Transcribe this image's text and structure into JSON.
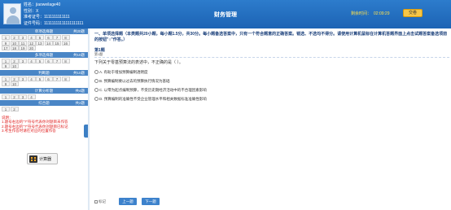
{
  "header": {
    "name_label": "姓名：",
    "name_value": "jiaoweilage40",
    "gender_label": "性别：",
    "gender_value": "X",
    "exam_id_label": "准考证号：",
    "exam_id_value": "1111111111111",
    "id_card_label": "证件号码：",
    "id_card_value": "11111111111111111111",
    "title": "财务管理",
    "time_label": "剩余时间：",
    "time_value": "02:09:29",
    "submit_label": "交卷"
  },
  "sidebar": {
    "sections": [
      {
        "title": "单项选择题",
        "count": "共20题",
        "rows": [
          [
            "1",
            "2",
            "3",
            "4",
            "5",
            "6",
            "7",
            "8"
          ],
          [
            "9",
            "10",
            "11",
            "12",
            "13",
            "14",
            "15",
            "16"
          ],
          [
            "17",
            "18",
            "19",
            "20"
          ]
        ]
      },
      {
        "title": "多项选择题",
        "count": "共10题",
        "rows": [
          [
            "1",
            "2",
            "3",
            "4",
            "5",
            "6",
            "7",
            "8"
          ],
          [
            "9",
            "10"
          ]
        ]
      },
      {
        "title": "判断题",
        "count": "共10题",
        "rows": [
          [
            "1",
            "2",
            "3",
            "4",
            "5",
            "6",
            "7",
            "8"
          ],
          [
            "9",
            "10"
          ]
        ]
      },
      {
        "title": "计算分析题",
        "count": "共4题",
        "rows": [
          [
            "1",
            "2",
            "3",
            "4"
          ]
        ]
      },
      {
        "title": "综合题",
        "count": "共2题",
        "rows": [
          [
            "1",
            "2"
          ]
        ]
      }
    ],
    "note_title": "说明：",
    "note_lines": [
      "1.题号右边的\"?\"符号代表你对题目未作答",
      "2.题号右边的\"?\"符号代表你对题目已标记",
      "3.考生作答时请在对应的位置作答"
    ],
    "calc_label": "计算器"
  },
  "main": {
    "section_title": "一、单项选择题（本类题共20小题，每小题1.5分，共30分。每小题备选答案中，只有一个符合题意的正确答案。错选、不选均不得分。请使用计算机鼠标在计算机答题界面上点击试题答案备选项前的按钮\"○\"作答。）",
    "question_number": "第1题",
    "question_small": "第1题",
    "question_stem": "下列关于零基预算法的表述中，不正确的是（ ）。",
    "options": [
      "A. 有助于增加预算编制透明度",
      "B. 预算编制要以过去的预算执行情况为基础",
      "C. 以零为起点编制预算，不受历史期经济活动中的不合理因素影响",
      "D. 预算编制的准确性不受企业管理水平和相关数据标准准确性影响"
    ],
    "mark_label": "标记",
    "prev_label": "上一题",
    "next_label": "下一题"
  },
  "colors": {
    "header_blue": "#1c63b4",
    "section_blue": "#4a86c6",
    "timer_yellow": "#ffe14a",
    "submit_gold": "#f8c646",
    "note_red": "#e02020"
  }
}
